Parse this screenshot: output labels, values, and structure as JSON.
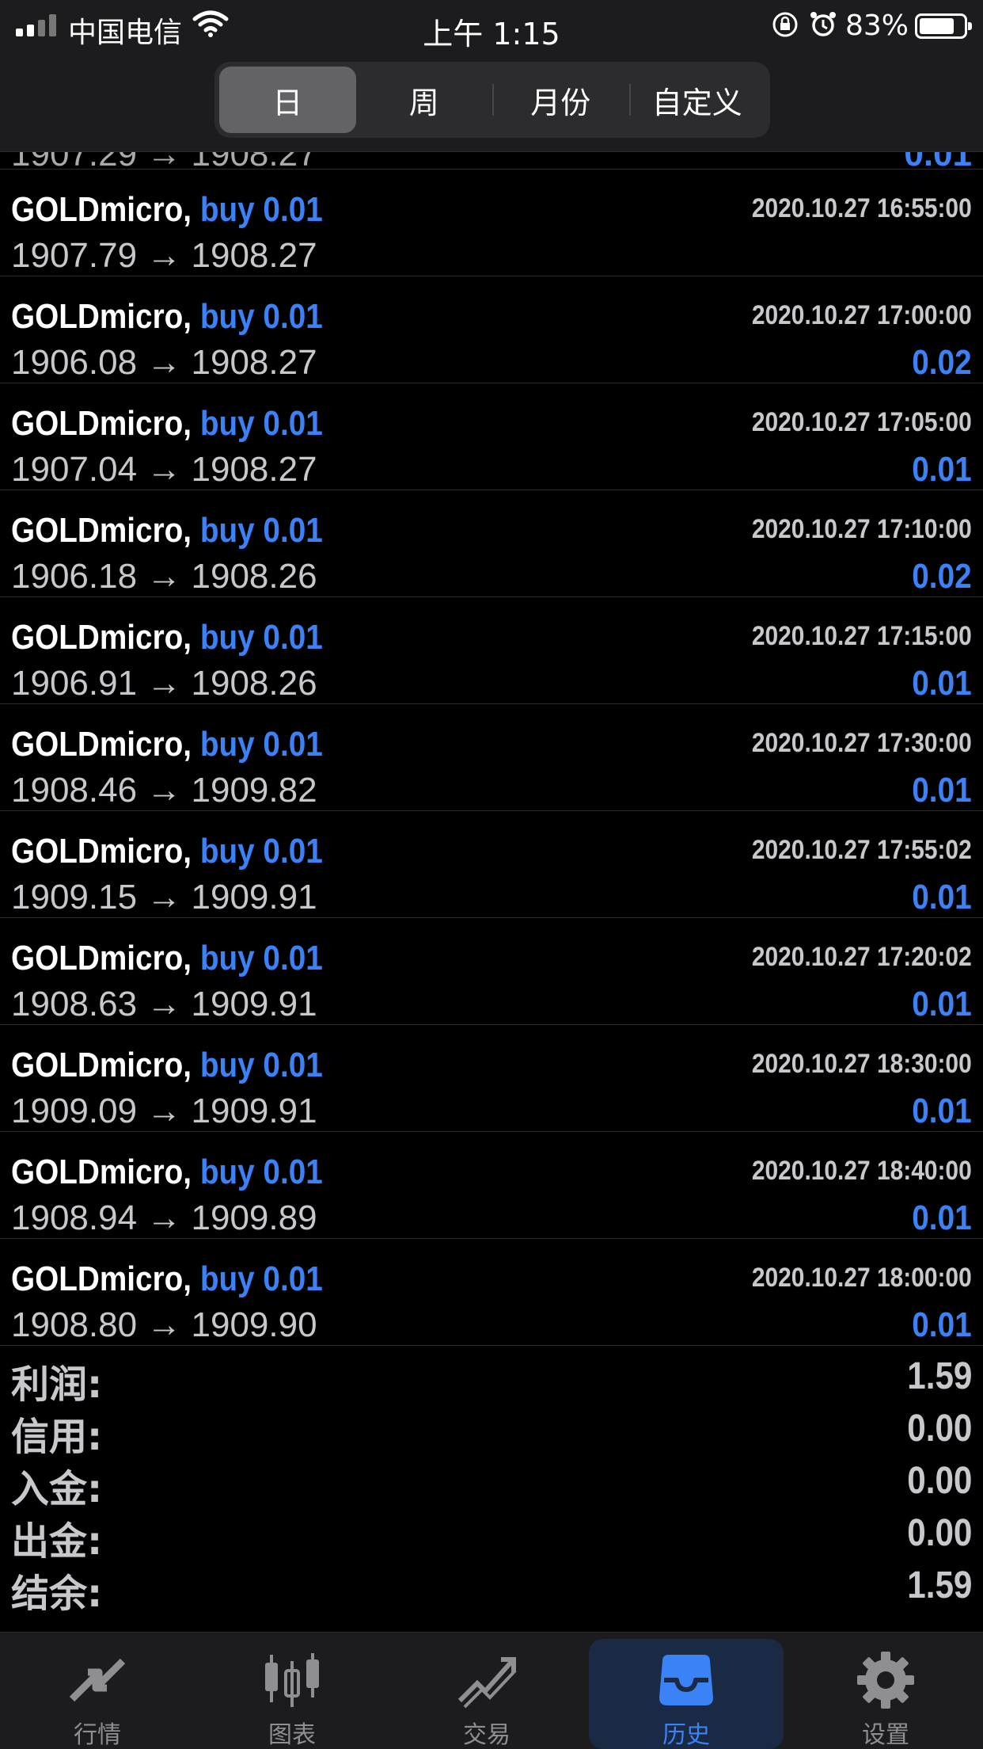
{
  "status_bar": {
    "carrier": "中国电信",
    "time": "上午 1:15",
    "battery_percent": "83%"
  },
  "tabs_period": [
    {
      "label": "日",
      "active": true
    },
    {
      "label": "周",
      "active": false
    },
    {
      "label": "月份",
      "active": false
    },
    {
      "label": "自定义",
      "active": false
    }
  ],
  "partial_row": {
    "prices": "1907.29 → 1908.27",
    "profit": "0.01"
  },
  "trades": [
    {
      "symbol": "GOLDmicro,",
      "side": "buy 0.01",
      "time": "2020.10.27 16:55:00",
      "prices": "1907.79 → 1908.27",
      "profit": ""
    },
    {
      "symbol": "GOLDmicro,",
      "side": "buy 0.01",
      "time": "2020.10.27 17:00:00",
      "prices": "1906.08 → 1908.27",
      "profit": "0.02"
    },
    {
      "symbol": "GOLDmicro,",
      "side": "buy 0.01",
      "time": "2020.10.27 17:05:00",
      "prices": "1907.04 → 1908.27",
      "profit": "0.01"
    },
    {
      "symbol": "GOLDmicro,",
      "side": "buy 0.01",
      "time": "2020.10.27 17:10:00",
      "prices": "1906.18 → 1908.26",
      "profit": "0.02"
    },
    {
      "symbol": "GOLDmicro,",
      "side": "buy 0.01",
      "time": "2020.10.27 17:15:00",
      "prices": "1906.91 → 1908.26",
      "profit": "0.01"
    },
    {
      "symbol": "GOLDmicro,",
      "side": "buy 0.01",
      "time": "2020.10.27 17:30:00",
      "prices": "1908.46 → 1909.82",
      "profit": "0.01"
    },
    {
      "symbol": "GOLDmicro,",
      "side": "buy 0.01",
      "time": "2020.10.27 17:55:02",
      "prices": "1909.15 → 1909.91",
      "profit": "0.01"
    },
    {
      "symbol": "GOLDmicro,",
      "side": "buy 0.01",
      "time": "2020.10.27 17:20:02",
      "prices": "1908.63 → 1909.91",
      "profit": "0.01"
    },
    {
      "symbol": "GOLDmicro,",
      "side": "buy 0.01",
      "time": "2020.10.27 18:30:00",
      "prices": "1909.09 → 1909.91",
      "profit": "0.01"
    },
    {
      "symbol": "GOLDmicro,",
      "side": "buy 0.01",
      "time": "2020.10.27 18:40:00",
      "prices": "1908.94 → 1909.89",
      "profit": "0.01"
    },
    {
      "symbol": "GOLDmicro,",
      "side": "buy 0.01",
      "time": "2020.10.27 18:00:00",
      "prices": "1908.80 → 1909.90",
      "profit": "0.01"
    }
  ],
  "summary": [
    {
      "label": "利润:",
      "value": "1.59"
    },
    {
      "label": "信用:",
      "value": "0.00"
    },
    {
      "label": "入金:",
      "value": "0.00"
    },
    {
      "label": "出金:",
      "value": "0.00"
    },
    {
      "label": "结余:",
      "value": "1.59"
    }
  ],
  "tabbar": [
    {
      "label": "行情",
      "icon": "quotes-icon",
      "active": false
    },
    {
      "label": "图表",
      "icon": "chart-icon",
      "active": false
    },
    {
      "label": "交易",
      "icon": "trade-icon",
      "active": false
    },
    {
      "label": "历史",
      "icon": "history-icon",
      "active": true
    },
    {
      "label": "设置",
      "icon": "settings-icon",
      "active": false
    }
  ],
  "colors": {
    "accent": "#3a82f6",
    "background": "#000000",
    "bar": "#1c1c1e"
  }
}
